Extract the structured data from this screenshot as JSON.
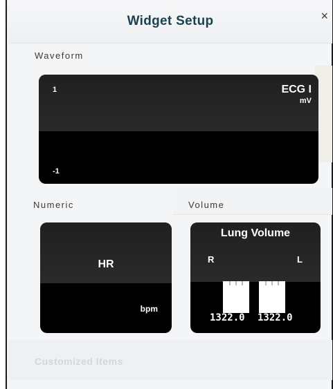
{
  "dialog": {
    "title": "Widget Setup",
    "close_glyph": "×"
  },
  "sections": {
    "waveform_label": "Waveform",
    "numeric_label": "Numeric",
    "volume_label": "Volume"
  },
  "waveform_widget": {
    "name": "ECG I",
    "unit": "mV",
    "scale_max": "1",
    "scale_min": "-1"
  },
  "numeric_widget": {
    "name": "HR",
    "unit": "bpm"
  },
  "volume_widget": {
    "name": "Lung Volume",
    "right_label": "R",
    "left_label": "L",
    "right_value": "1322.0",
    "left_value": "1322.0"
  },
  "background": {
    "faded_text": "Customized Items"
  },
  "colors": {
    "title_text": "#1e4150",
    "widget_bg": "#000000",
    "widget_band": "#262626",
    "widget_text": "#ffffff"
  }
}
